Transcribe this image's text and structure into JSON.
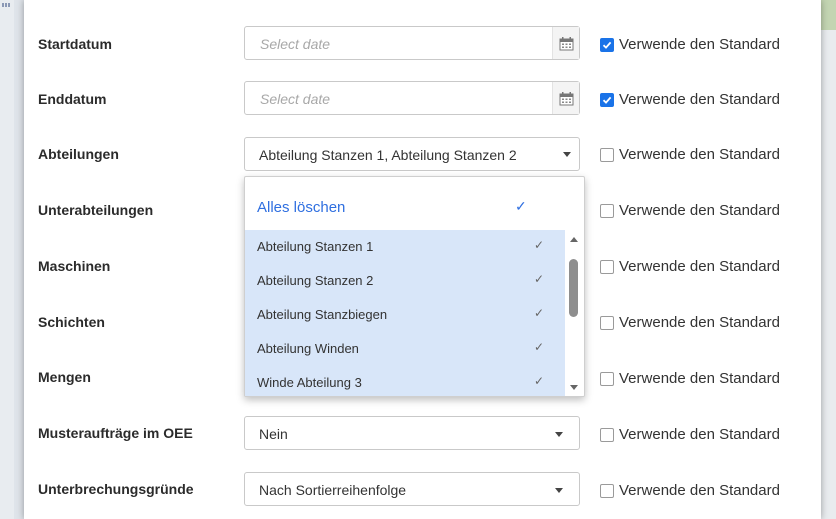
{
  "fields": [
    {
      "label": "Startdatum",
      "placeholder": "Select date",
      "default_label": "Verwende den Standard",
      "default_checked": true
    },
    {
      "label": "Enddatum",
      "placeholder": "Select date",
      "default_label": "Verwende den Standard",
      "default_checked": true
    },
    {
      "label": "Abteilungen",
      "value": "Abteilung Stanzen 1, Abteilung Stanzen 2",
      "default_label": "Verwende den Standard",
      "default_checked": false
    },
    {
      "label": "Unterabteilungen",
      "default_label": "Verwende den Standard",
      "default_checked": false
    },
    {
      "label": "Maschinen",
      "default_label": "Verwende den Standard",
      "default_checked": false
    },
    {
      "label": "Schichten",
      "default_label": "Verwende den Standard",
      "default_checked": false
    },
    {
      "label": "Mengen",
      "default_label": "Verwende den Standard",
      "default_checked": false
    },
    {
      "label": "Musteraufträge im OEE",
      "value": "Nein",
      "default_label": "Verwende den Standard",
      "default_checked": false
    },
    {
      "label": "Unterbrechungsgründe",
      "value": "Nach Sortierreihenfolge",
      "default_label": "Verwende den Standard",
      "default_checked": false
    }
  ],
  "dropdown": {
    "clear_all": "Alles löschen",
    "items": [
      {
        "label": "Abteilung Stanzen 1",
        "selected": true
      },
      {
        "label": "Abteilung Stanzen 2",
        "selected": true
      },
      {
        "label": "Abteilung Stanzbiegen",
        "selected": true
      },
      {
        "label": "Abteilung Winden",
        "selected": true
      },
      {
        "label": "Winde Abteilung 3",
        "selected": true
      }
    ]
  },
  "icons": {
    "calendar": "calendar-icon",
    "caret": "caret-down-icon",
    "check": "check-icon"
  },
  "colors": {
    "accent": "#1a73e8",
    "link": "#2f6fe0",
    "selected_bg": "#d8e6f9"
  }
}
